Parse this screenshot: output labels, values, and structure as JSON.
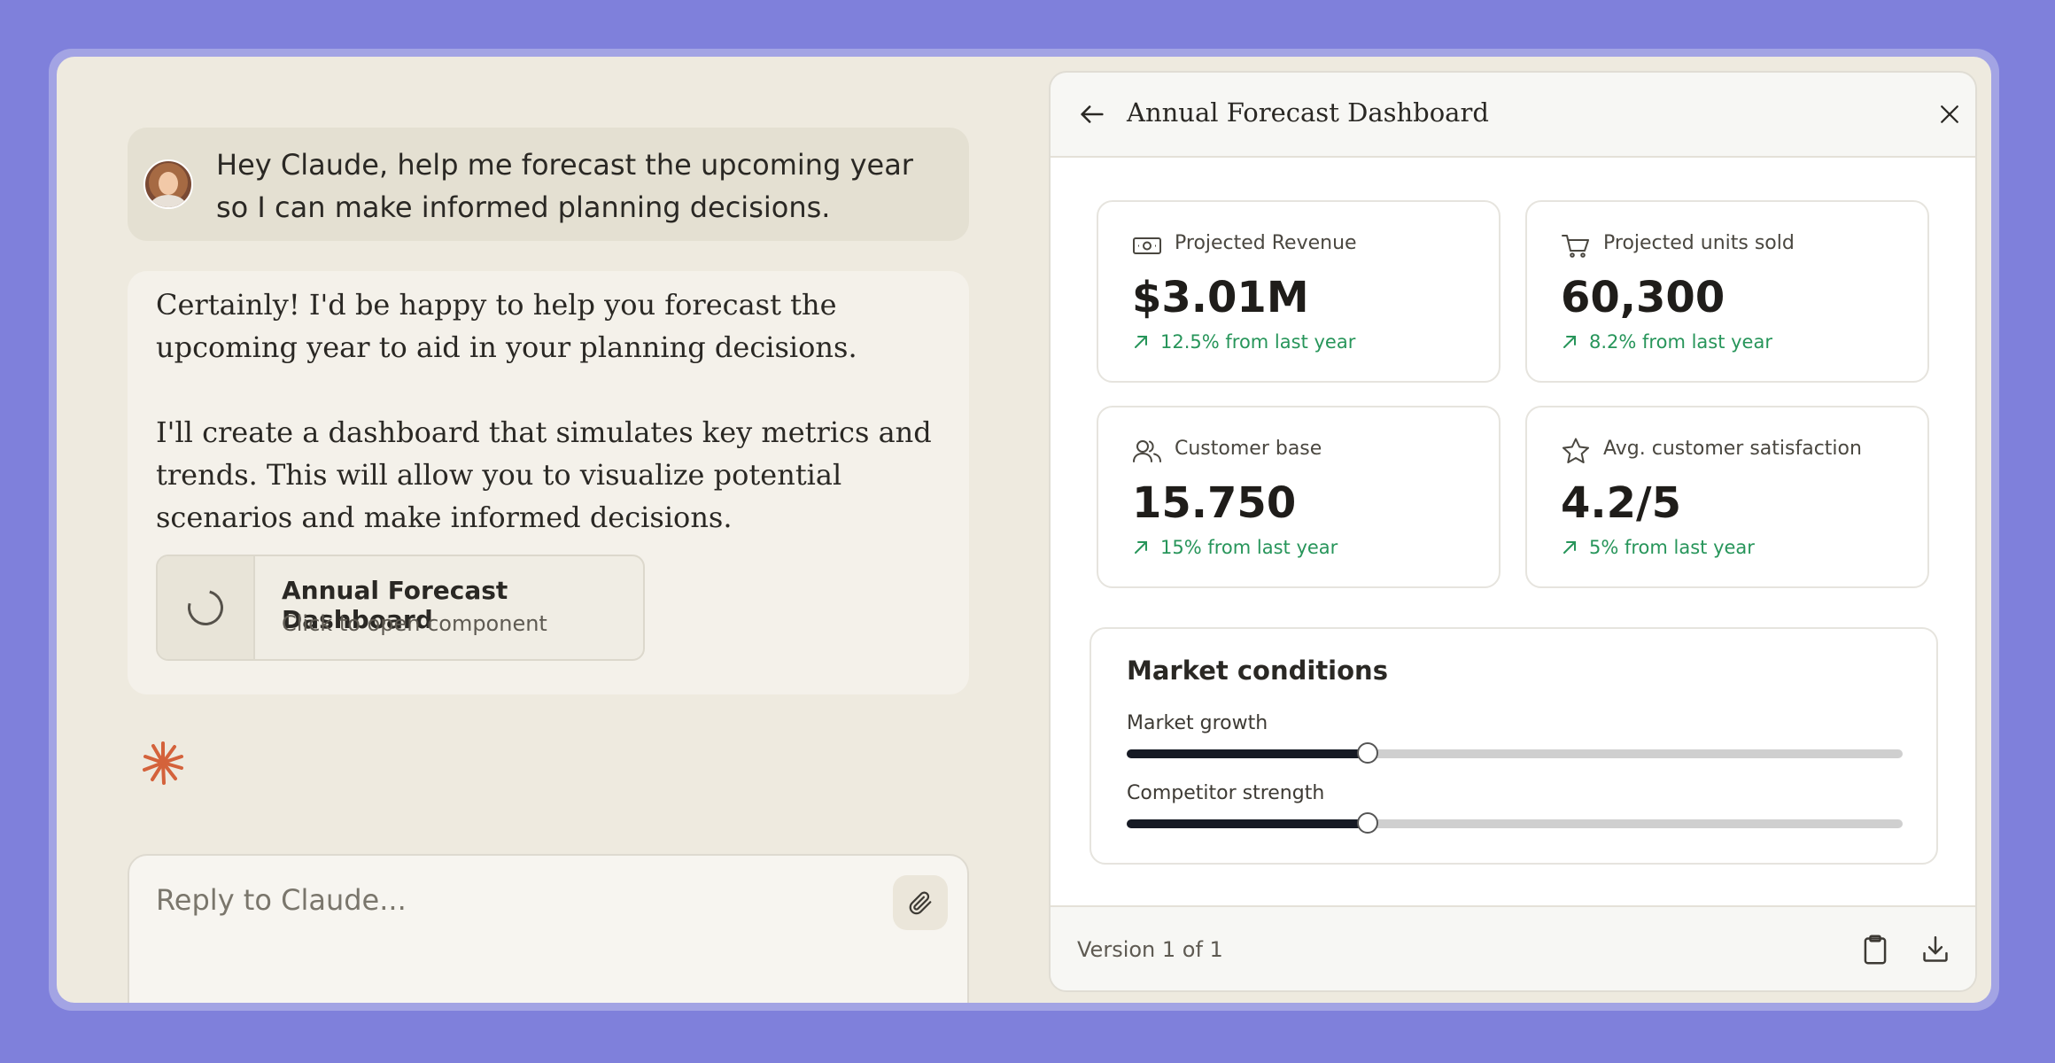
{
  "chat": {
    "user_message": "Hey Claude, help me forecast the upcoming year so I can make informed planning decisions.",
    "assistant_paragraph_1": "Certainly! I'd be happy to help you forecast the upcoming year to aid in your planning decisions.",
    "assistant_paragraph_2": "I'll create a dashboard that simulates key metrics and trends. This will allow you to visualize potential scenarios and make informed decisions.",
    "artifact": {
      "title": "Annual Forecast Dashboard",
      "subtitle": "Click to open component"
    },
    "reply_placeholder": "Reply to Claude..."
  },
  "panel": {
    "title": "Annual Forecast Dashboard",
    "metrics": [
      {
        "icon": "banknote-icon",
        "label": "Projected Revenue",
        "value": "$3.01M",
        "change": "12.5% from last year"
      },
      {
        "icon": "cart-icon",
        "label": "Projected units sold",
        "value": "60,300",
        "change": "8.2% from last year"
      },
      {
        "icon": "users-icon",
        "label": "Customer base",
        "value": "15.750",
        "change": "15% from last year"
      },
      {
        "icon": "star-icon",
        "label": "Avg. customer satisfaction",
        "value": "4.2/5",
        "change": "5% from last year"
      }
    ],
    "market": {
      "title": "Market conditions",
      "sliders": [
        {
          "label": "Market growth",
          "value": 0.31
        },
        {
          "label": "Competitor strength",
          "value": 0.31
        }
      ]
    },
    "footer": {
      "version": "Version 1 of 1"
    }
  },
  "colors": {
    "background": "#7f80db",
    "positive_change": "#27955a",
    "claude_mark": "#d4623b",
    "slider_fill": "#161a24"
  }
}
